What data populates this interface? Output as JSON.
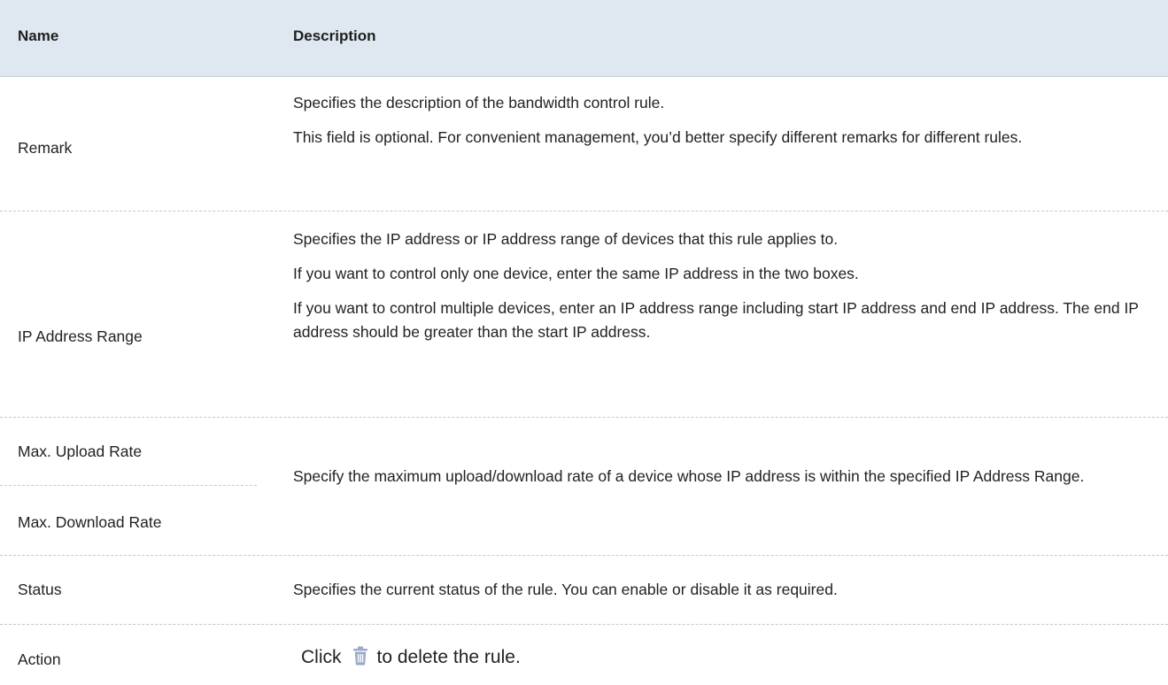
{
  "header": {
    "name": "Name",
    "description": "Description"
  },
  "rows": [
    {
      "name": "Remark",
      "paragraphs": [
        "Specifies the description of the bandwidth control rule.",
        "This field is optional. For convenient management, you’d better specify different remarks for different rules."
      ]
    },
    {
      "name": "IP Address Range",
      "paragraphs": [
        "Specifies the IP address or IP address range of devices that this rule applies to.",
        "If you want to control only one device, enter the same IP address in the two boxes.",
        "If you want to control multiple devices, enter an IP address range including start IP address and end IP address. The end IP address should be greater than the start IP address."
      ]
    },
    {
      "names": [
        "Max. Upload Rate",
        "Max. Download Rate"
      ],
      "paragraphs": [
        "Specify the maximum upload/download rate of a device whose IP address is within the specified IP Address Range."
      ]
    },
    {
      "name": "Status",
      "paragraphs": [
        "Specifies the current status of the rule. You can enable or disable it as required."
      ]
    },
    {
      "name": "Action",
      "action": {
        "before": "Click",
        "icon": "trash-icon",
        "after": "to delete the rule."
      }
    }
  ],
  "colors": {
    "header_bg": "#dfe8f1",
    "icon_color": "#9aa8c9"
  }
}
